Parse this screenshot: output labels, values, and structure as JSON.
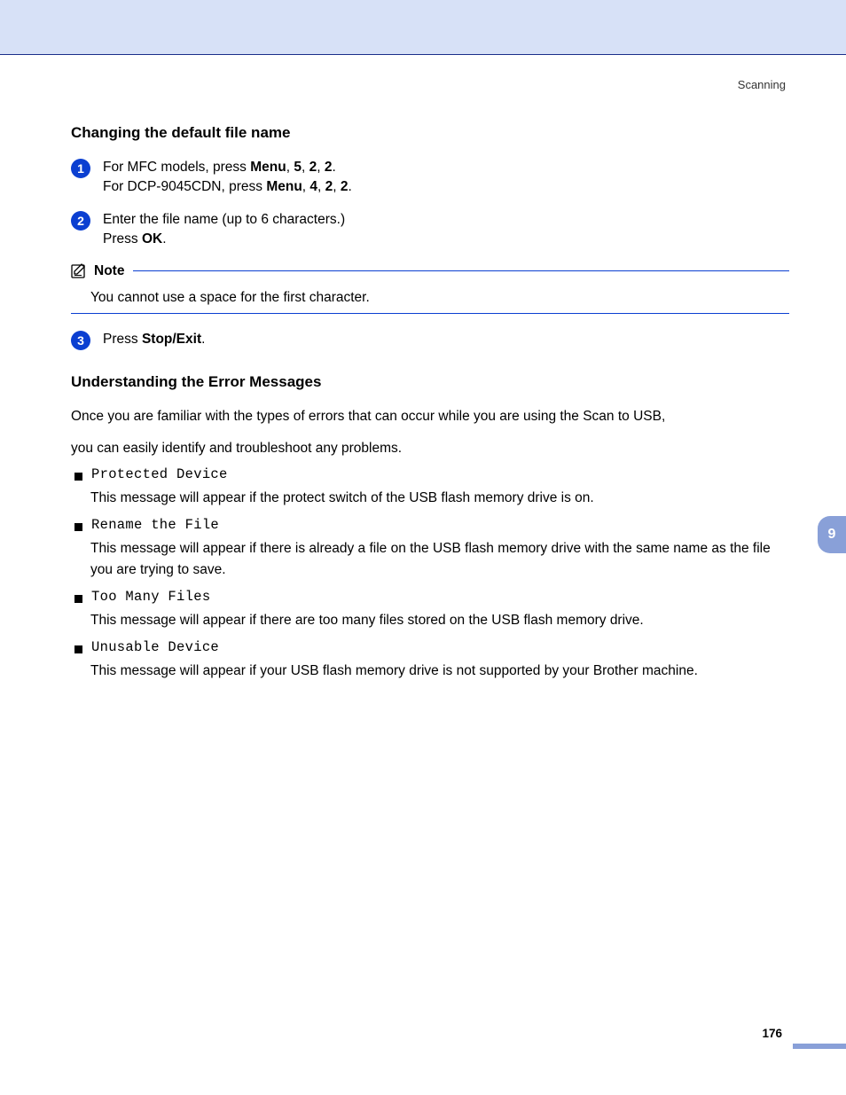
{
  "header": {
    "section_label": "Scanning"
  },
  "section1": {
    "heading": "Changing the default file name",
    "step1": {
      "num": "1",
      "l1a": "For MFC models, press ",
      "l1b_menu": "Menu",
      "l1b_c1": ", ",
      "l1b_5": "5",
      "l1b_c2": ", ",
      "l1b_2a": "2",
      "l1b_c3": ", ",
      "l1b_2b": "2",
      "l1b_end": ".",
      "l2a": "For DCP-9045CDN, press ",
      "l2b_menu": "Menu",
      "l2b_c1": ", ",
      "l2b_4": "4",
      "l2b_c2": ", ",
      "l2b_2a": "2",
      "l2b_c3": ", ",
      "l2b_2b": "2",
      "l2b_end": "."
    },
    "step2": {
      "num": "2",
      "l1": "Enter the file name (up to 6 characters.)",
      "l2a": "Press ",
      "l2b_ok": "OK",
      "l2c": "."
    },
    "note": {
      "title": "Note",
      "body": "You cannot use a space for the first character."
    },
    "step3": {
      "num": "3",
      "l1a": "Press ",
      "l1b": "Stop/Exit",
      "l1c": "."
    }
  },
  "section2": {
    "heading": "Understanding the Error Messages",
    "intro1": "Once you are familiar with the types of errors that can occur while you are using the Scan to USB,",
    "intro2": "you can easily identify and troubleshoot any problems.",
    "errors": {
      "e1": {
        "name": "Protected Device",
        "desc": "This message will appear if the protect switch of the USB flash memory drive is on."
      },
      "e2": {
        "name": "Rename the File",
        "desc": "This message will appear if there is already a file on the USB flash memory drive with the same name as the file you are trying to save."
      },
      "e3": {
        "name": "Too Many Files",
        "desc": "This message will appear if there are too many files stored on the USB flash memory drive."
      },
      "e4": {
        "name": "Unusable Device",
        "desc": "This message will appear if your USB flash memory drive is not supported by your Brother machine."
      }
    }
  },
  "side_tab": "9",
  "page_number": "176"
}
